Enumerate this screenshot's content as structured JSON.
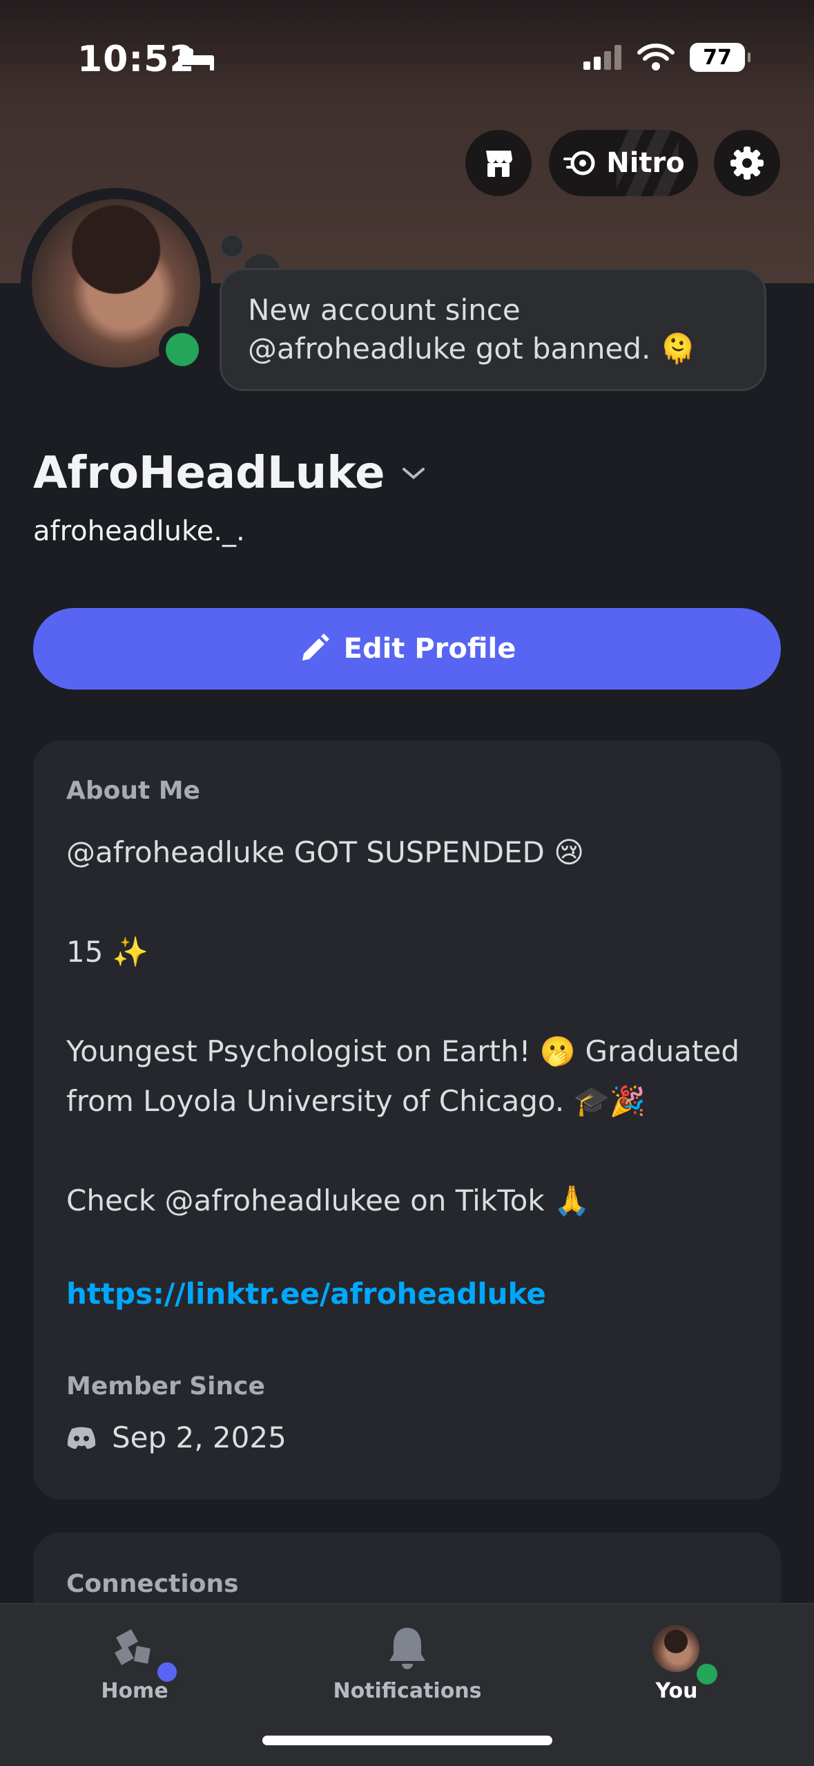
{
  "status_bar": {
    "time": "10:52",
    "battery": "77"
  },
  "header": {
    "nitro_label": "Nitro"
  },
  "custom_status": "New account since @afroheadluke got banned. 🫠",
  "profile": {
    "display_name": "AfroHeadLuke",
    "username": "afroheadluke._."
  },
  "edit_profile_label": "Edit Profile",
  "about": {
    "heading": "About Me",
    "lines": [
      "@afroheadluke GOT SUSPENDED 😢",
      "15 ✨",
      "Youngest Psychologist on Earth! 🫢 Graduated from Loyola University of Chicago. 🎓🎉",
      "Check @afroheadlukee on TikTok 🙏"
    ],
    "link": "https://linktr.ee/afroheadluke"
  },
  "member_since": {
    "heading": "Member Since",
    "date": "Sep 2, 2025"
  },
  "connections_heading": "Connections",
  "tabs": [
    {
      "label": "Home"
    },
    {
      "label": "Notifications"
    },
    {
      "label": "You"
    }
  ],
  "colors": {
    "accent": "#5865f2",
    "online": "#23a55a",
    "link": "#00a8fc"
  }
}
